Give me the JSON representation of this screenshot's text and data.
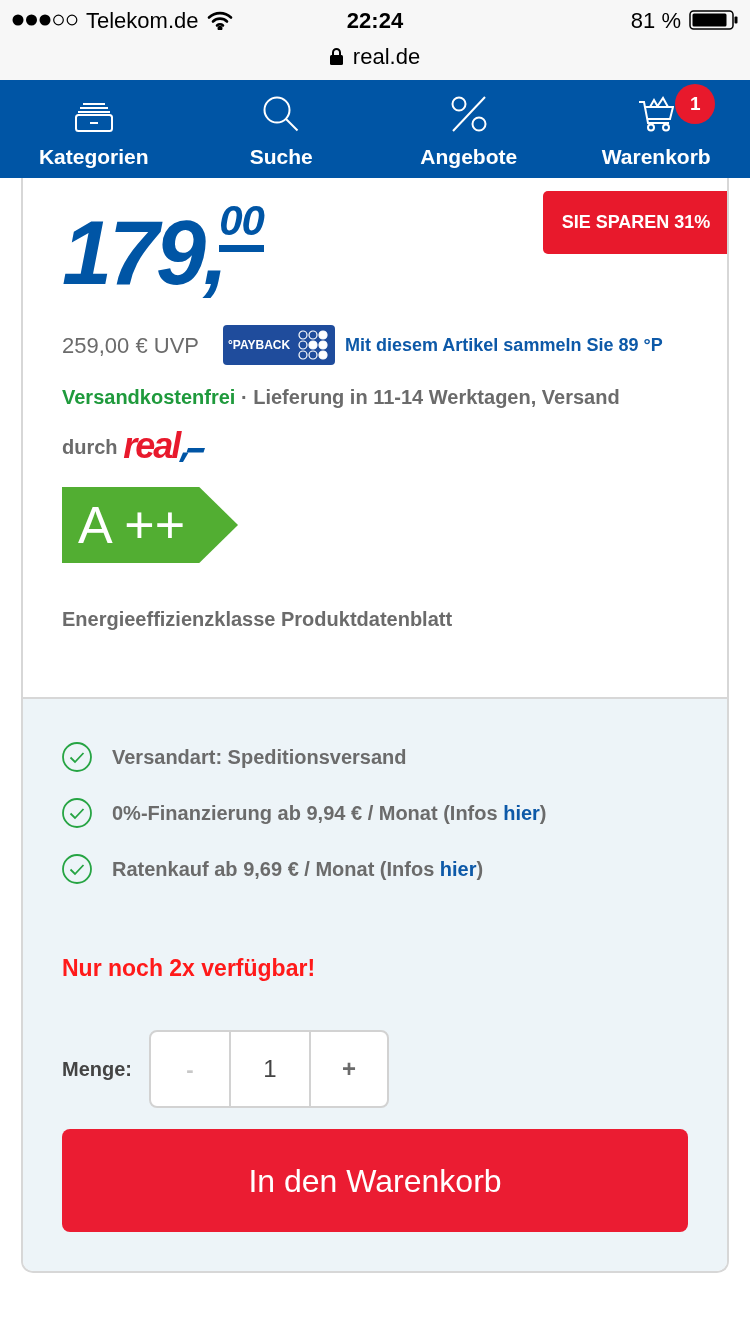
{
  "status_bar": {
    "carrier": "Telekom.de",
    "time": "22:24",
    "battery": "81 %"
  },
  "address_bar": {
    "url": "real.de"
  },
  "nav": {
    "items": [
      {
        "label": "Kategorien",
        "kind": "tray"
      },
      {
        "label": "Suche",
        "kind": "search"
      },
      {
        "label": "Angebote",
        "kind": "percent"
      },
      {
        "label": "Warenkorb",
        "kind": "cart",
        "badge": "1"
      }
    ]
  },
  "product": {
    "discount_badge": "SIE SPAREN 31%",
    "price": {
      "amount": "179,",
      "cents": "00"
    },
    "list_price": "259,00 € UVP",
    "payback": {
      "logo": "°PAYBACK",
      "text": "Mit diesem Artikel sammeln Sie 89 °P"
    },
    "delivery": {
      "free_shipping": "Versandkostenfrei",
      "text": " · Lieferung in 11-14 Werktagen, Versand durch ",
      "seller_logo": "real"
    },
    "energy_label": {
      "class": "A ++"
    },
    "energy_text": "Energieeffizienzklasse Produktdatenblatt"
  },
  "purchase": {
    "features": [
      {
        "text": "Versandart: Speditionsversand"
      },
      {
        "text": "0%-Finanzierung ab 9,94 € / Monat (Infos ",
        "link": "hier",
        "after": ")"
      },
      {
        "text": "Ratenkauf ab 9,69 € / Monat (Infos ",
        "link": "hier",
        "after": ")"
      }
    ],
    "stock_notice": "Nur noch 2x verfügbar!",
    "quantity": {
      "label": "Menge:",
      "decrement": {
        "symbol": "-",
        "disabled": true
      },
      "value": "1",
      "increment": {
        "symbol": "+",
        "disabled": false
      }
    },
    "add_to_cart": "In den Warenkorb"
  }
}
